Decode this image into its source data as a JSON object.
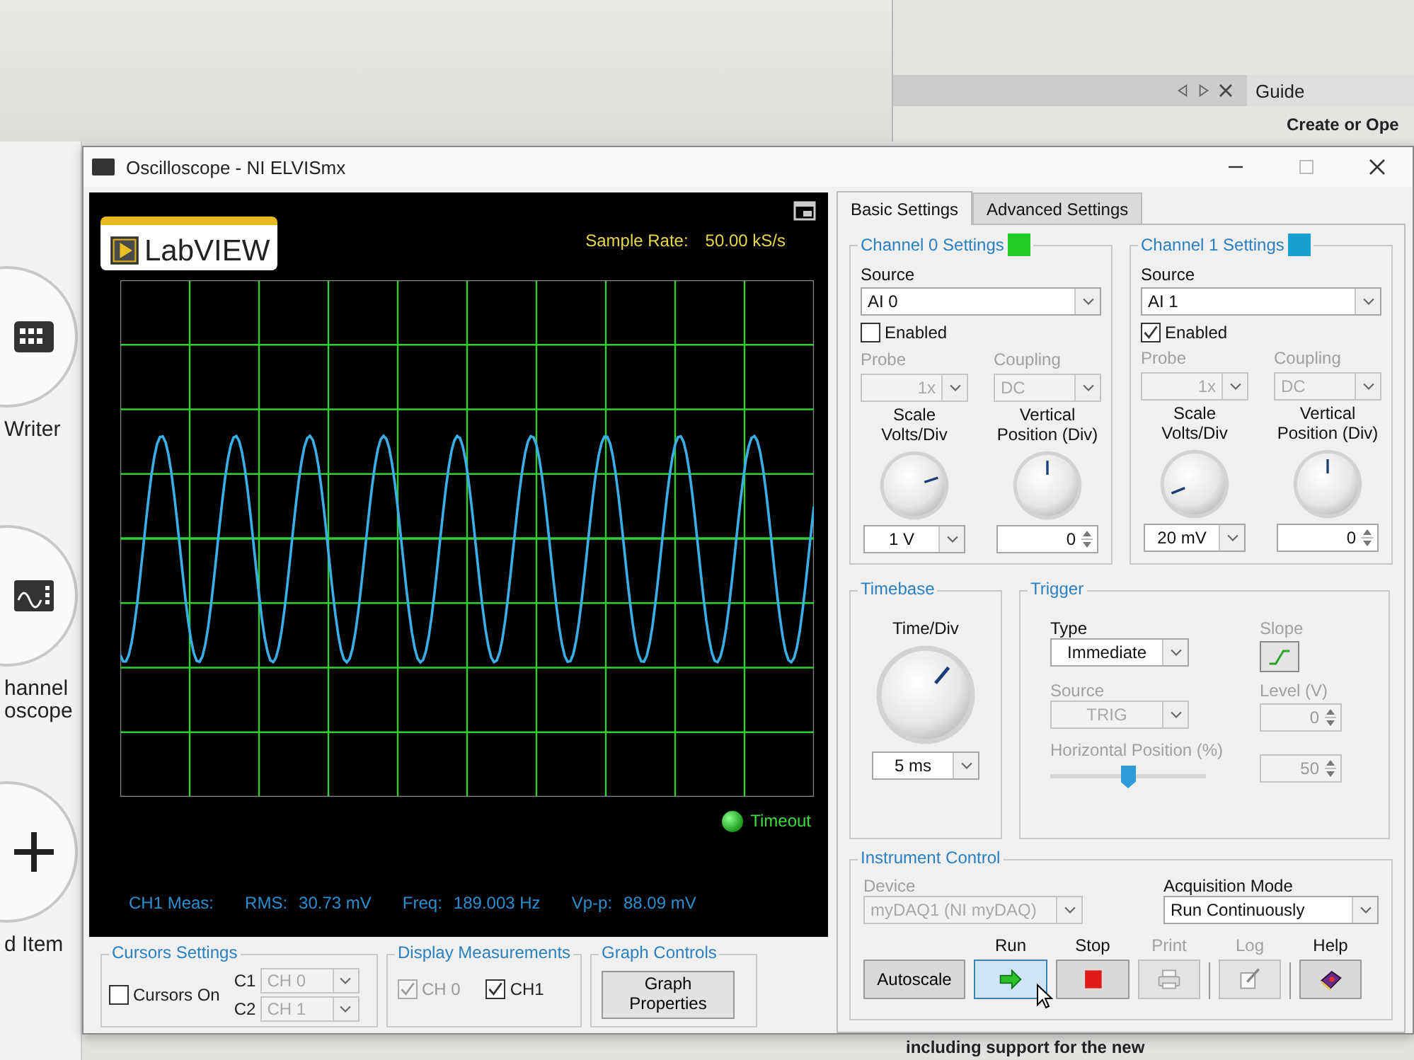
{
  "background": {
    "sidebar_items": [
      {
        "label": "Writer",
        "kind": "writer"
      },
      {
        "label": "hannel\noscope",
        "kind": "scope"
      },
      {
        "label": "d Item",
        "kind": "add"
      }
    ],
    "guide_tab": "Guide",
    "guide_link": "Create or Ope",
    "footer_text": "including support for the new"
  },
  "window": {
    "title": "Oscilloscope - NI ELVISmx"
  },
  "display": {
    "logo_text": "LabVIEW",
    "sample_rate_label": "Sample Rate:",
    "sample_rate_value": "50.00 kS/s",
    "timeout": {
      "label": "Timeout",
      "on": true
    },
    "measurements_label": "CH1 Meas:",
    "measurements": [
      {
        "label": "RMS:",
        "value": "30.73 mV"
      },
      {
        "label": "Freq:",
        "value": "189.003 Hz"
      },
      {
        "label": "Vp-p:",
        "value": "88.09 mV"
      }
    ]
  },
  "cursors_settings": {
    "title": "Cursors Settings",
    "cursors_on": {
      "label": "Cursors On",
      "checked": false
    },
    "cursors": [
      {
        "label": "C1",
        "value": "CH 0",
        "disabled": true
      },
      {
        "label": "C2",
        "value": "CH 1",
        "disabled": true
      }
    ]
  },
  "display_measurements": {
    "title": "Display Measurements",
    "channels": [
      {
        "label": "CH 0",
        "checked": true,
        "disabled": true
      },
      {
        "label": "CH1",
        "checked": true,
        "disabled": false
      }
    ]
  },
  "graph_controls": {
    "title": "Graph Controls",
    "button": "Graph\nProperties"
  },
  "tabs": [
    {
      "label": "Basic Settings",
      "selected": true
    },
    {
      "label": "Advanced Settings",
      "selected": false
    }
  ],
  "channels": [
    {
      "title": "Channel 0 Settings",
      "color": "#22cc22",
      "source_label": "Source",
      "source": "AI 0",
      "enabled_label": "Enabled",
      "enabled": false,
      "probe": {
        "label": "Probe",
        "value": "1x",
        "disabled": true
      },
      "coupling": {
        "label": "Coupling",
        "value": "DC",
        "disabled": true
      },
      "scale": {
        "label": "Scale\nVolts/Div",
        "kind": "east",
        "value": "1 V"
      },
      "position": {
        "label": "Vertical\nPosition (Div)",
        "kind": "north",
        "value": "0"
      }
    },
    {
      "title": "Channel 1 Settings",
      "color": "#1aa0d0",
      "source_label": "Source",
      "source": "AI 1",
      "enabled_label": "Enabled",
      "enabled": true,
      "probe": {
        "label": "Probe",
        "value": "1x",
        "disabled": true
      },
      "coupling": {
        "label": "Coupling",
        "value": "DC",
        "disabled": true
      },
      "scale": {
        "label": "Scale\nVolts/Div",
        "kind": "southwest",
        "value": "20 mV"
      },
      "position": {
        "label": "Vertical\nPosition (Div)",
        "kind": "north",
        "value": "0"
      }
    }
  ],
  "timebase": {
    "title": "Timebase",
    "label": "Time/Div",
    "kind": "northeast",
    "value": "5 ms"
  },
  "trigger": {
    "title": "Trigger",
    "type": {
      "label": "Type",
      "value": "Immediate",
      "disabled": false
    },
    "source": {
      "label": "Source",
      "value": "TRIG",
      "disabled": true
    },
    "slope_label": "Slope",
    "level": {
      "label": "Level (V)",
      "value": "0",
      "disabled": true
    },
    "horizontal_position": {
      "label": "Horizontal Position (%)",
      "level": 0.5,
      "value": "50",
      "disabled": true
    }
  },
  "instrument_control": {
    "title": "Instrument Control",
    "device": {
      "label": "Device",
      "value": "myDAQ1 (NI myDAQ)",
      "disabled": true
    },
    "acquisition_mode": {
      "label": "Acquisition Mode",
      "value": "Run Continuously",
      "disabled": false
    },
    "buttons": [
      {
        "kind": "autoscale",
        "label": "Autoscale",
        "disabled": false,
        "highlighted": false
      },
      {
        "kind": "run",
        "caption": "Run",
        "disabled": false,
        "highlighted": true
      },
      {
        "kind": "stop",
        "caption": "Stop",
        "disabled": false,
        "highlighted": false
      },
      {
        "kind": "print",
        "caption": "Print",
        "disabled": true,
        "highlighted": false
      },
      {
        "kind": "log",
        "caption": "Log",
        "disabled": true,
        "highlighted": false
      },
      {
        "kind": "help",
        "caption": "Help",
        "disabled": false,
        "highlighted": false
      }
    ]
  }
}
